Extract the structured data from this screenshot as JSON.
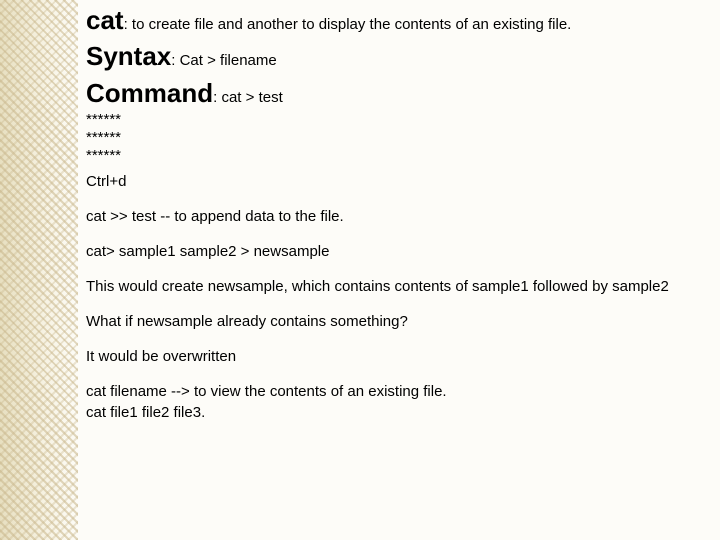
{
  "heading": {
    "cat_label": "cat",
    "cat_desc": ": to create file and another to display the contents of an existing file.",
    "syntax_label": "Syntax",
    "syntax_value": ": Cat > filename",
    "command_label": "Command",
    "command_value": ": cat > test"
  },
  "stars": {
    "row1": "******",
    "row2": "******",
    "row3": "******"
  },
  "body": {
    "ctrld": "Ctrl+d",
    "append": "cat >> test  -- to append data to the file.",
    "samplecmd": "cat> sample1 sample2 > newsample",
    "sampledesc": "This would create newsample, which contains contents of sample1 followed by sample2",
    "whatif": "What if newsample already contains something?",
    "overwrite": "It would be overwritten",
    "view1": "cat filename  --> to view the contents of an existing file.",
    "view2": "cat file1 file2 file3."
  }
}
